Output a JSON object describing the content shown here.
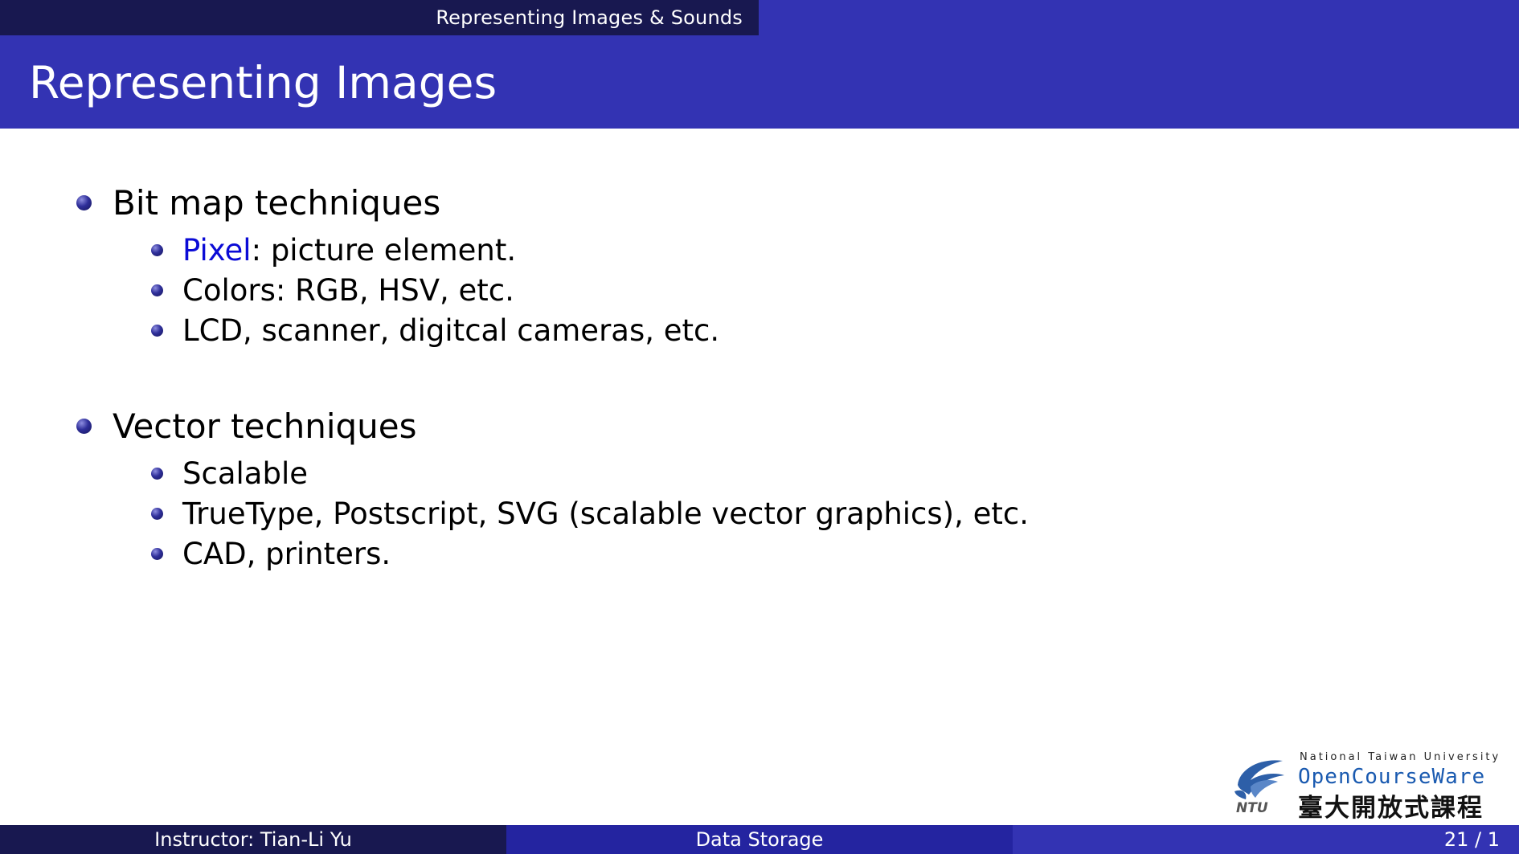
{
  "header": {
    "section_title": "Representing Images & Sounds"
  },
  "frame": {
    "title": "Representing Images"
  },
  "content": {
    "items": [
      {
        "label": "Bit map techniques",
        "subitems": [
          {
            "highlight": "Pixel",
            "text": ": picture element."
          },
          {
            "text": "Colors: RGB, HSV, etc."
          },
          {
            "text": "LCD, scanner, digitcal cameras, etc."
          }
        ]
      },
      {
        "label": "Vector techniques",
        "subitems": [
          {
            "text": "Scalable"
          },
          {
            "text": "TrueType, Postscript, SVG (scalable vector graphics), etc."
          },
          {
            "text": "CAD, printers."
          }
        ]
      }
    ]
  },
  "logo": {
    "university": "National Taiwan University",
    "brand": "OpenCourseWare",
    "chinese": "臺大開放式課程",
    "emblem_text": "NTU"
  },
  "footer": {
    "instructor": "Instructor: Tian-Li Yu",
    "course": "Data Storage",
    "page": "21 / 1"
  },
  "colors": {
    "theme_dark": "#181850",
    "theme_mid": "#2424a0",
    "theme_light": "#3333b3",
    "highlight": "#0b0bd6"
  }
}
